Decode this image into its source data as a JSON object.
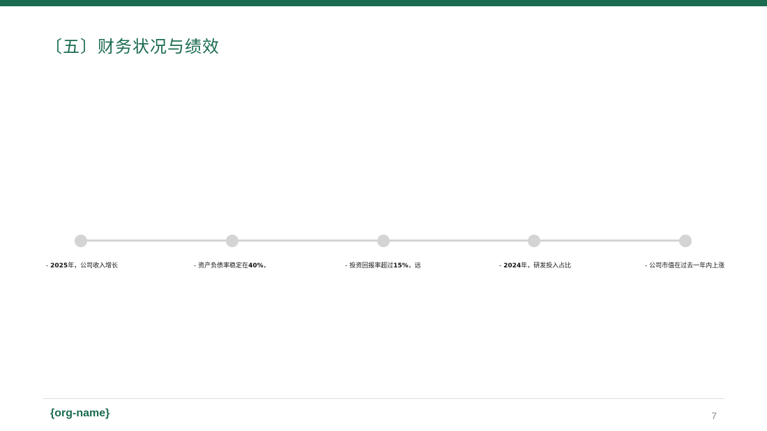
{
  "header": {
    "accent_color": "#1a6b50",
    "title": "〔五〕财务状况与绩效"
  },
  "timeline": {
    "line_color": "#d4d4d4",
    "items": [
      {
        "prefix": "- ",
        "bold": "2025",
        "text": "年，公司收入增长"
      },
      {
        "prefix": "- 资产负债率稳定在",
        "bold": "40%",
        "text": "，"
      },
      {
        "prefix": "- 投资回报率超过",
        "bold": "15%",
        "text": "，远"
      },
      {
        "prefix": "- ",
        "bold": "2024",
        "text": "年，研发投入占比"
      },
      {
        "prefix": "- 公司市值在过去一年内上涨",
        "bold": "",
        "text": ""
      }
    ]
  },
  "footer": {
    "org_name": "{org-name}",
    "page_number": "7"
  }
}
